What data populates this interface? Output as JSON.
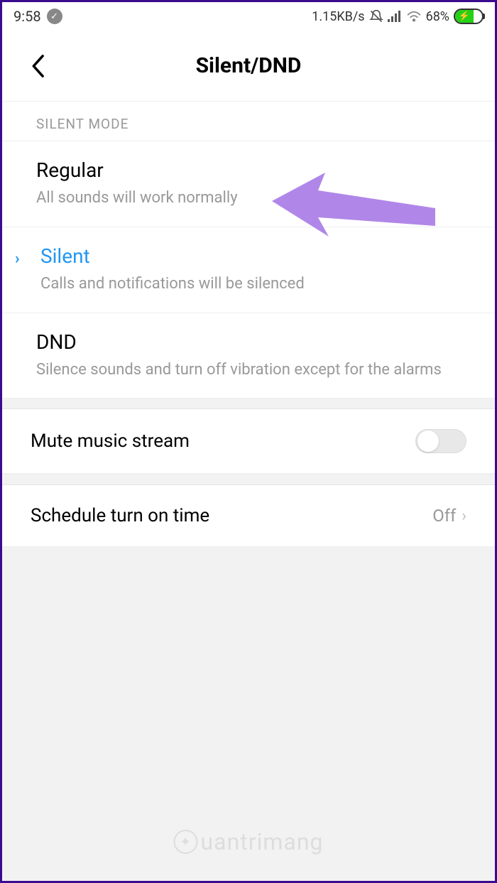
{
  "status_bar": {
    "time": "9:58",
    "network_speed": "1.15KB/s",
    "battery_percent": "68%"
  },
  "header": {
    "title": "Silent/DND"
  },
  "section": {
    "label": "SILENT MODE",
    "options": [
      {
        "title": "Regular",
        "description": "All sounds will work normally",
        "selected": false
      },
      {
        "title": "Silent",
        "description": "Calls and notifications will be silenced",
        "selected": true
      },
      {
        "title": "DND",
        "description": "Silence sounds and turn off vibration except for the alarms",
        "selected": false
      }
    ]
  },
  "rows": {
    "mute_music": {
      "label": "Mute music stream",
      "enabled": false
    },
    "schedule": {
      "label": "Schedule turn on time",
      "value": "Off"
    }
  },
  "watermark": "uantrimang"
}
